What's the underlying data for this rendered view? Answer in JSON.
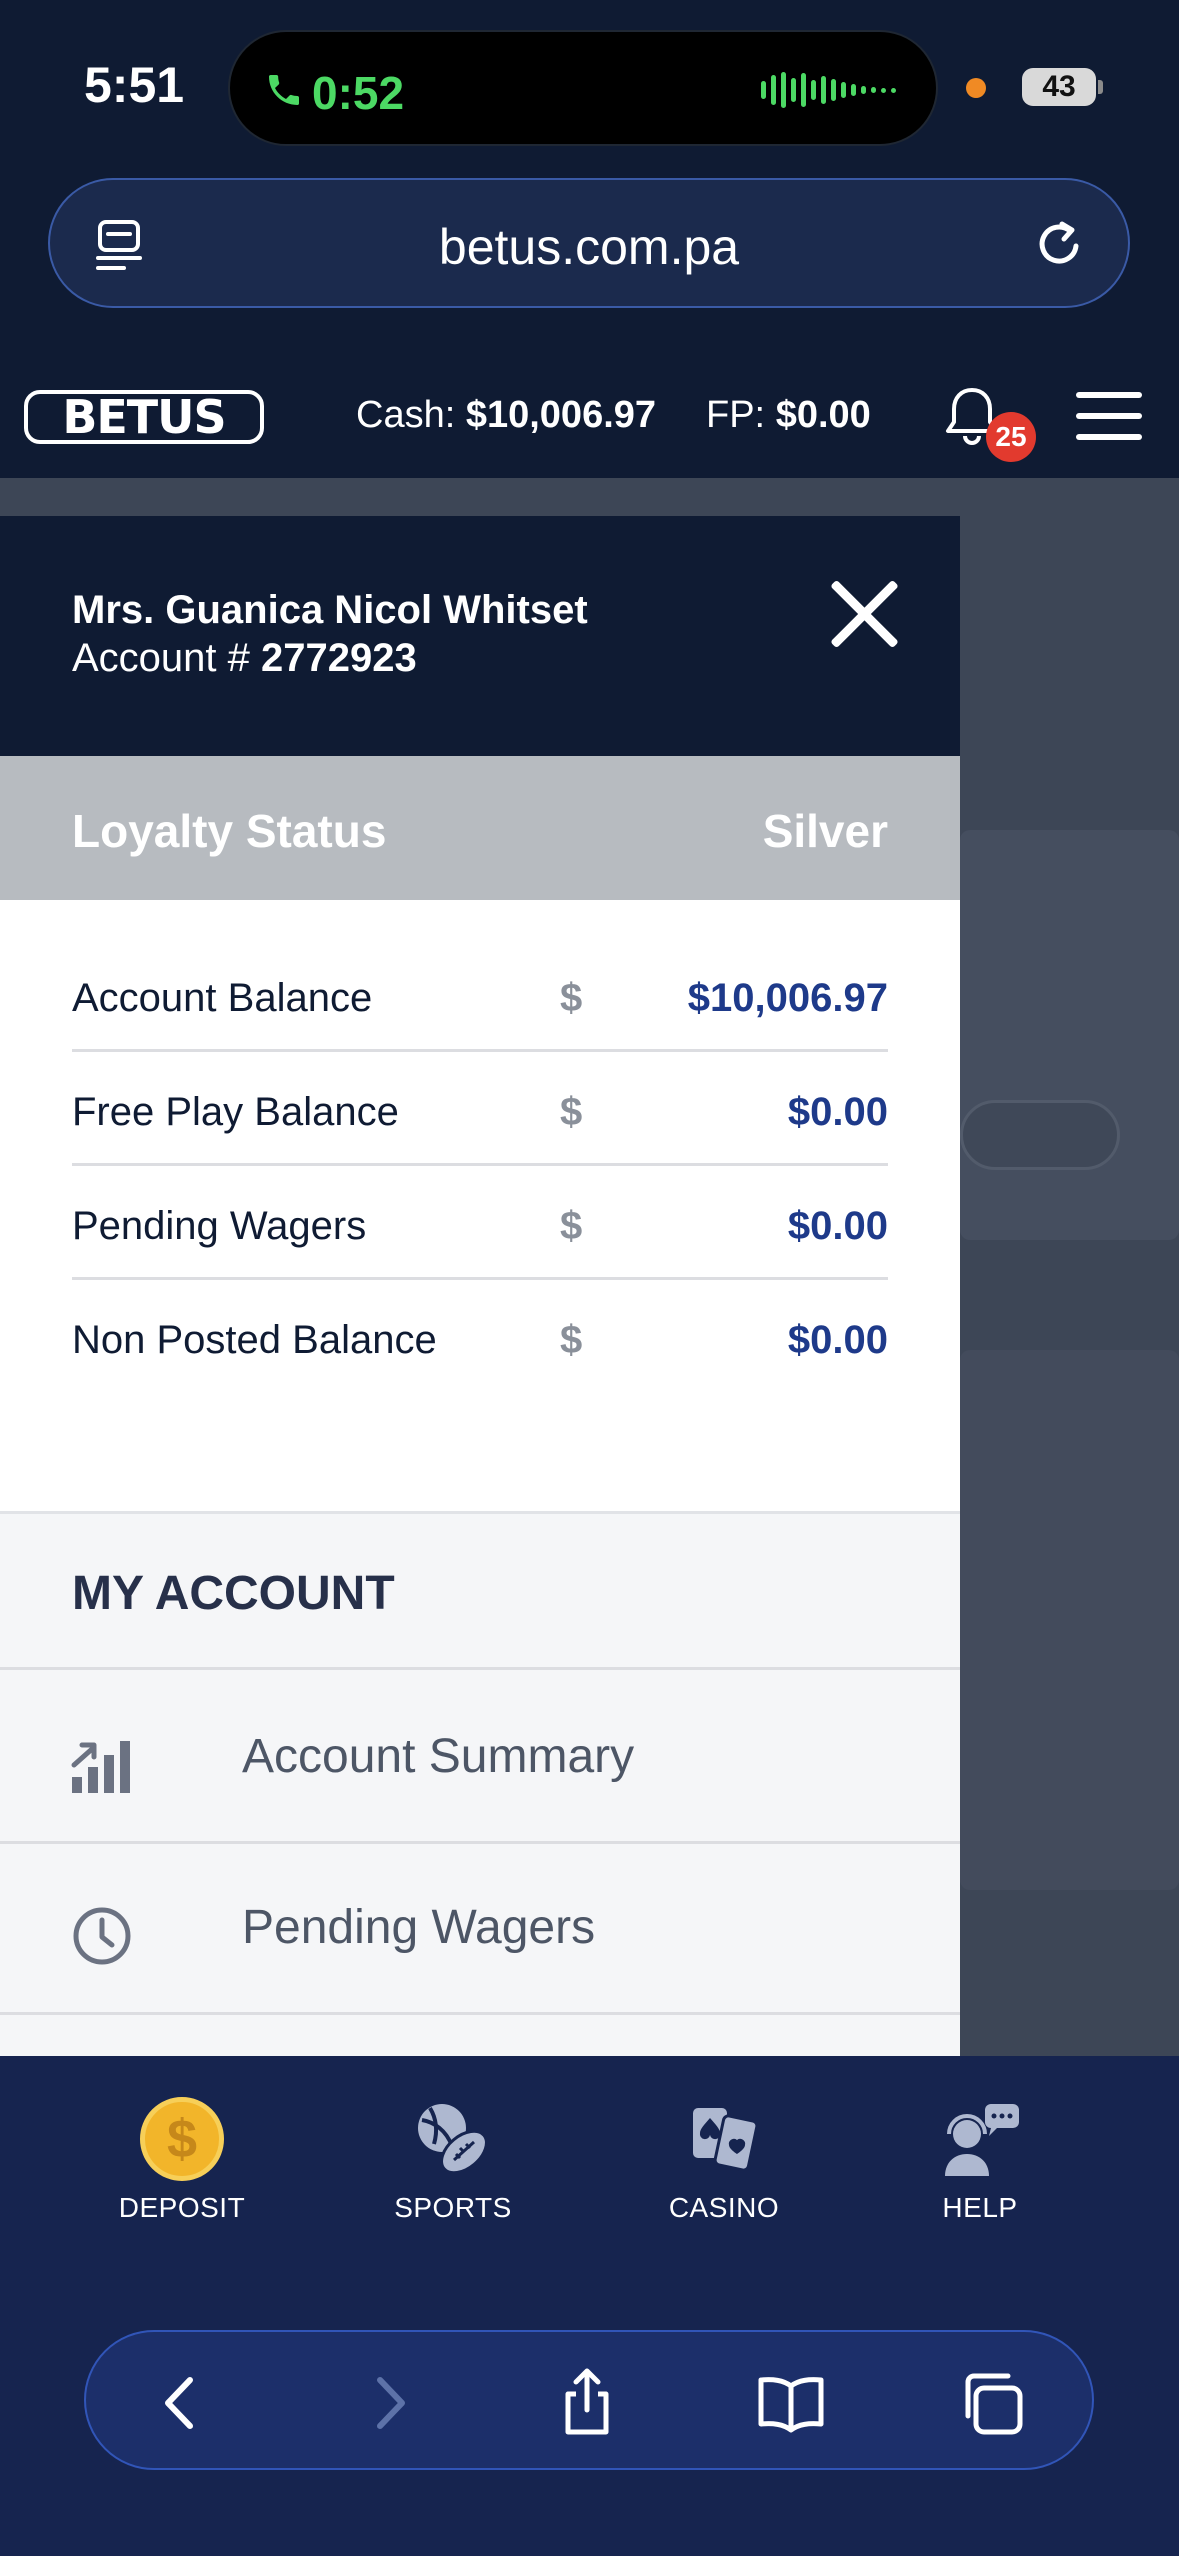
{
  "status_bar": {
    "time": "5:51",
    "call_time": "0:52",
    "battery": "43"
  },
  "browser": {
    "url": "betus.com.pa"
  },
  "header": {
    "logo": "BETUS",
    "cash_label": "Cash:",
    "cash_value": "$10,006.97",
    "fp_label": "FP:",
    "fp_value": "$0.00",
    "notification_count": "25"
  },
  "drawer": {
    "user_name": "Mrs. Guanica Nicol Whitset",
    "account_label": "Account #",
    "account_number": "2772923",
    "loyalty_label": "Loyalty Status",
    "loyalty_value": "Silver",
    "balances": [
      {
        "label": "Account Balance",
        "sign": "$",
        "value": "$10,006.97"
      },
      {
        "label": "Free Play Balance",
        "sign": "$",
        "value": "$0.00"
      },
      {
        "label": "Pending Wagers",
        "sign": "$",
        "value": "$0.00"
      },
      {
        "label": "Non Posted Balance",
        "sign": "$",
        "value": "$0.00"
      }
    ],
    "section_title": "MY ACCOUNT",
    "menu": [
      {
        "label": "Account Summary",
        "icon": "bar-chart-icon"
      },
      {
        "label": "Pending Wagers",
        "icon": "clock-icon"
      }
    ]
  },
  "tabbar": [
    {
      "label": "DEPOSIT",
      "icon": "dollar-coin-icon"
    },
    {
      "label": "SPORTS",
      "icon": "sports-balls-icon"
    },
    {
      "label": "CASINO",
      "icon": "playing-cards-icon"
    },
    {
      "label": "HELP",
      "icon": "support-agent-icon"
    }
  ],
  "colors": {
    "navy": "#0f1b33",
    "value_blue": "#1e3a8a",
    "badge_red": "#e23a2e",
    "coin_gold": "#f2b52a",
    "call_green": "#4cd964"
  }
}
